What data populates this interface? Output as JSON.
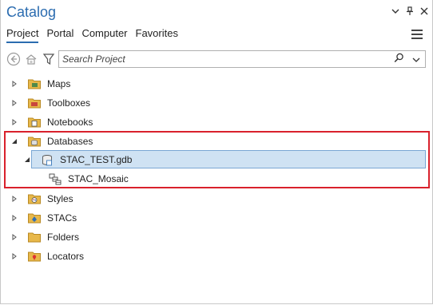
{
  "window": {
    "title": "Catalog"
  },
  "tabs": [
    "Project",
    "Portal",
    "Computer",
    "Favorites"
  ],
  "search": {
    "placeholder": "Search Project"
  },
  "tree": {
    "maps": "Maps",
    "toolboxes": "Toolboxes",
    "notebooks": "Notebooks",
    "databases": "Databases",
    "gdb": "STAC_TEST.gdb",
    "mosaic": "STAC_Mosaic",
    "styles": "Styles",
    "stacs": "STACs",
    "folders": "Folders",
    "locators": "Locators"
  },
  "colors": {
    "accent": "#2b6cb0",
    "highlight_box": "#d9212c",
    "selection": "#cfe2f3",
    "folder": "#e8b84a"
  },
  "icons": [
    "chevron-down-icon",
    "pin-icon",
    "close-icon",
    "hamburger-menu-icon",
    "back-icon",
    "home-icon",
    "filter-icon",
    "search-icon",
    "folder-icon",
    "geodatabase-icon",
    "mosaic-dataset-icon"
  ]
}
